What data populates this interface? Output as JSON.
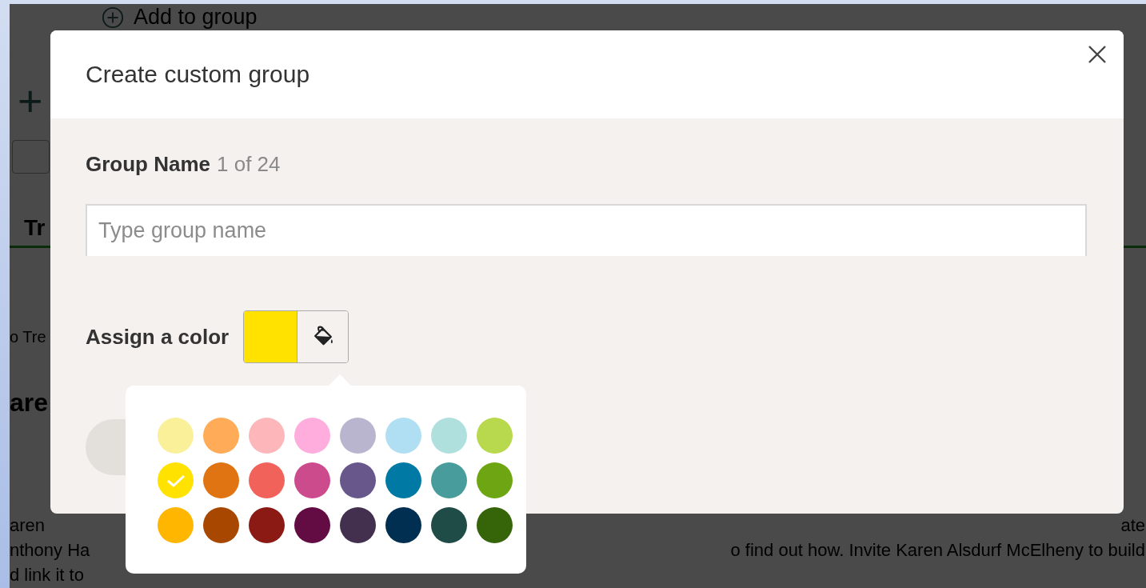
{
  "background": {
    "add_link": "Add to group",
    "plus": "+",
    "tab": "Tr",
    "crumb": "o Tre",
    "heading": "are",
    "lines": [
      {
        "left": "aren",
        "right": "ate"
      },
      {
        "left": "nthony Ha",
        "right": "o find out how. Invite Karen Alsdurf McElheny to build"
      },
      {
        "left": "d link it to"
      }
    ]
  },
  "dialog": {
    "title": "Create custom group",
    "name_label": "Group Name",
    "counter": "1 of 24",
    "placeholder": "Type group name",
    "color_label": "Assign a color"
  },
  "palette": [
    [
      {
        "color": "#fbf09a",
        "selected": false
      },
      {
        "color": "#ffab57",
        "selected": false
      },
      {
        "color": "#fdb7bb",
        "selected": false
      },
      {
        "color": "#ffaddc",
        "selected": false
      },
      {
        "color": "#bab5cf",
        "selected": false
      },
      {
        "color": "#b0dff4",
        "selected": false
      },
      {
        "color": "#b0e0dd",
        "selected": false
      },
      {
        "color": "#b8d84d",
        "selected": false
      }
    ],
    [
      {
        "color": "#ffe200",
        "selected": true
      },
      {
        "color": "#e07412",
        "selected": false
      },
      {
        "color": "#f0625a",
        "selected": false
      },
      {
        "color": "#cc4b8c",
        "selected": false
      },
      {
        "color": "#67578a",
        "selected": false
      },
      {
        "color": "#007aa5",
        "selected": false
      },
      {
        "color": "#489d9c",
        "selected": false
      },
      {
        "color": "#6ea613",
        "selected": false
      }
    ],
    [
      {
        "color": "#ffb600",
        "selected": false
      },
      {
        "color": "#a84700",
        "selected": false
      },
      {
        "color": "#8c1a14",
        "selected": false
      },
      {
        "color": "#630c44",
        "selected": false
      },
      {
        "color": "#43304f",
        "selected": false
      },
      {
        "color": "#002f52",
        "selected": false
      },
      {
        "color": "#1f4c47",
        "selected": false
      },
      {
        "color": "#356409",
        "selected": false
      }
    ]
  ]
}
